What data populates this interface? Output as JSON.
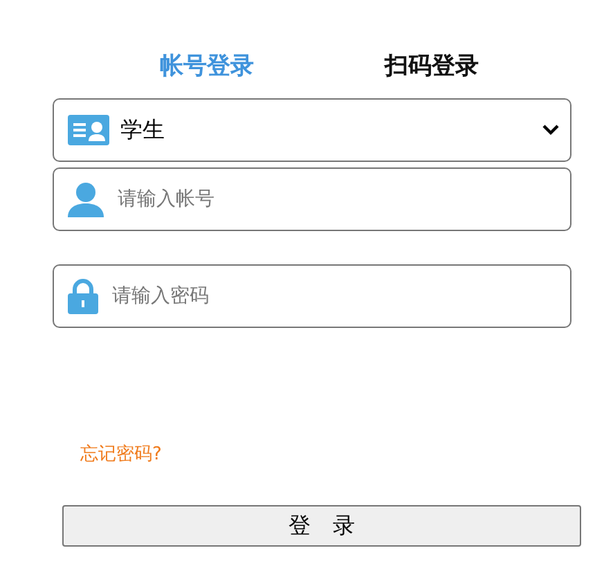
{
  "tabs": [
    {
      "label": "帐号登录",
      "selected": true
    },
    {
      "label": "扫码登录",
      "selected": false
    }
  ],
  "role_select": {
    "value": "学生"
  },
  "account_field": {
    "placeholder": "请输入帐号"
  },
  "password_field": {
    "placeholder": "请输入密码"
  },
  "forgot_link": "忘记密码?",
  "login_button": "登　录"
}
